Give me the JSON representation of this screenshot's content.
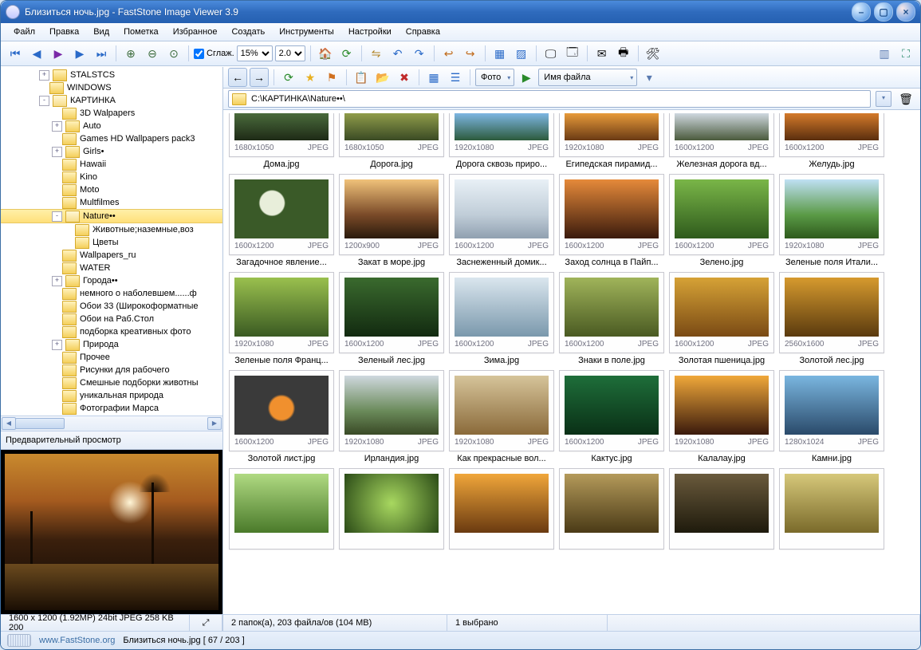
{
  "title": "Близиться ночь.jpg  -  FastStone Image Viewer 3.9",
  "menu": [
    "Файл",
    "Правка",
    "Вид",
    "Пометка",
    "Избранное",
    "Создать",
    "Инструменты",
    "Настройки",
    "Справка"
  ],
  "toolbar1": {
    "smooth_label": "Сглаж.",
    "zoom_pct": "15%",
    "zoom_x": "2.0"
  },
  "rtoolbar": {
    "combo1": "Фото",
    "combo2": "Имя файла"
  },
  "path": "С:\\КАРТИНКА\\Nature••\\",
  "preview_label": "Предварительный просмотр",
  "tree": [
    {
      "d": 3,
      "e": "+",
      "t": "STALSTCS"
    },
    {
      "d": 3,
      "e": "",
      "t": "WINDOWS"
    },
    {
      "d": 3,
      "e": "-",
      "t": "КАРТИНКА",
      "open": true
    },
    {
      "d": 4,
      "e": "",
      "t": "3D Walpapers"
    },
    {
      "d": 4,
      "e": "+",
      "t": "Auto"
    },
    {
      "d": 4,
      "e": "",
      "t": "Games HD Wallpapers pack3"
    },
    {
      "d": 4,
      "e": "+",
      "t": "Girls•"
    },
    {
      "d": 4,
      "e": "",
      "t": "Hawaii"
    },
    {
      "d": 4,
      "e": "",
      "t": "Kino"
    },
    {
      "d": 4,
      "e": "",
      "t": "Moto"
    },
    {
      "d": 4,
      "e": "",
      "t": "Multfilmes"
    },
    {
      "d": 4,
      "e": "-",
      "t": "Nature••",
      "sel": true,
      "open": true
    },
    {
      "d": 5,
      "e": "",
      "t": "Животные;наземные,воз"
    },
    {
      "d": 5,
      "e": "",
      "t": "Цветы"
    },
    {
      "d": 4,
      "e": "",
      "t": "Wallpapers_ru"
    },
    {
      "d": 4,
      "e": "",
      "t": "WATER"
    },
    {
      "d": 4,
      "e": "+",
      "t": "Города••"
    },
    {
      "d": 4,
      "e": "",
      "t": "немного о наболевшем......ф"
    },
    {
      "d": 4,
      "e": "",
      "t": "Обои 33 (Широкоформатные"
    },
    {
      "d": 4,
      "e": "",
      "t": "Обои на Раб.Стол"
    },
    {
      "d": 4,
      "e": "",
      "t": "подборка креативных фото"
    },
    {
      "d": 4,
      "e": "+",
      "t": "Природа"
    },
    {
      "d": 4,
      "e": "",
      "t": "Прочее"
    },
    {
      "d": 4,
      "e": "",
      "t": "Рисунки для рабочего"
    },
    {
      "d": 4,
      "e": "",
      "t": "Смешные подборки животны"
    },
    {
      "d": 4,
      "e": "",
      "t": "уникальная природа"
    },
    {
      "d": 4,
      "e": "",
      "t": "Фотографии Марса"
    }
  ],
  "thumbs": [
    [
      {
        "r": "1680x1050",
        "f": "JPEG",
        "n": "Дома.jpg",
        "bg": "linear-gradient(#4a6b3c,#1e2a16)"
      },
      {
        "r": "1680x1050",
        "f": "JPEG",
        "n": "Дорога.jpg",
        "bg": "linear-gradient(#8f9c4a,#3a4a24)"
      },
      {
        "r": "1920x1080",
        "f": "JPEG",
        "n": "Дорога сквозь приро...",
        "bg": "linear-gradient(#7db6e3,#2c5a3c)"
      },
      {
        "r": "1920x1080",
        "f": "JPEG",
        "n": "Египедская пирамид...",
        "bg": "linear-gradient(#e79a3a,#6a3a14)"
      },
      {
        "r": "1600x1200",
        "f": "JPEG",
        "n": "Железная дорога вд...",
        "bg": "linear-gradient(#cfd8e0,#4a5a3c)"
      },
      {
        "r": "1600x1200",
        "f": "JPEG",
        "n": "Желудь.jpg",
        "bg": "linear-gradient(#d47a2a,#5a2e0e)"
      }
    ],
    [
      {
        "r": "1600x1200",
        "f": "JPEG",
        "n": "Загадочное явление...",
        "bg": "radial-gradient(circle at 40% 40%,#e8eeda 0 18%,#3a5a28 20%)"
      },
      {
        "r": "1200x900",
        "f": "JPEG",
        "n": "Закат в море.jpg",
        "bg": "linear-gradient(#f0c27a,#7a4a28 60%,#2a1a0c)"
      },
      {
        "r": "1600x1200",
        "f": "JPEG",
        "n": "Заснеженный домик...",
        "bg": "linear-gradient(#e8f0f6,#c0cdd8 60%,#90a0b0)"
      },
      {
        "r": "1600x1200",
        "f": "JPEG",
        "n": "Заход солнца в Пайп...",
        "bg": "linear-gradient(#e68a3a,#3a1a0c)"
      },
      {
        "r": "1600x1200",
        "f": "JPEG",
        "n": "Зелено.jpg",
        "bg": "linear-gradient(#7ab648,#2e5a1c)"
      },
      {
        "r": "1920x1080",
        "f": "JPEG",
        "n": "Зеленые поля Итали...",
        "bg": "linear-gradient(#bfe0f4,#5a9a46 60%,#2e5a1c)"
      }
    ],
    [
      {
        "r": "1920x1080",
        "f": "JPEG",
        "n": "Зеленые поля Франц...",
        "bg": "linear-gradient(#9ac04e,#3a5a22)"
      },
      {
        "r": "1600x1200",
        "f": "JPEG",
        "n": "Зеленый лес.jpg",
        "bg": "linear-gradient(#3a6a2e,#122a10)"
      },
      {
        "r": "1600x1200",
        "f": "JPEG",
        "n": "Зима.jpg",
        "bg": "linear-gradient(#dae6ee,#7a98ac)"
      },
      {
        "r": "1600x1200",
        "f": "JPEG",
        "n": "Знаки в поле.jpg",
        "bg": "linear-gradient(#a0b45a,#4a5a22)"
      },
      {
        "r": "1600x1200",
        "f": "JPEG",
        "n": "Золотая пшеница.jpg",
        "bg": "linear-gradient(#d6a236,#7a4a14)"
      },
      {
        "r": "2560x1600",
        "f": "JPEG",
        "n": "Золотой лес.jpg",
        "bg": "linear-gradient(#d69a2e,#5a3a0e)"
      }
    ],
    [
      {
        "r": "1600x1200",
        "f": "JPEG",
        "n": "Золотой лист.jpg",
        "bg": "radial-gradient(circle at 50% 55%,#f0902e 0 20%,#3a3a3a 24%)"
      },
      {
        "r": "1920x1080",
        "f": "JPEG",
        "n": "Ирландия.jpg",
        "bg": "linear-gradient(#cfd8de,#6a8a5a 60%,#3a4a26)"
      },
      {
        "r": "1920x1080",
        "f": "JPEG",
        "n": "Как прекрасные вол...",
        "bg": "linear-gradient(#d6c49a,#8a6a3a)"
      },
      {
        "r": "1600x1200",
        "f": "JPEG",
        "n": "Кактус.jpg",
        "bg": "linear-gradient(#1e6e3a,#0a3016)"
      },
      {
        "r": "1920x1080",
        "f": "JPEG",
        "n": "Калалау.jpg",
        "bg": "linear-gradient(#f0a83a,#3a1a0c)"
      },
      {
        "r": "1280x1024",
        "f": "JPEG",
        "n": "Камни.jpg",
        "bg": "linear-gradient(#7ab6e0,#2a4a6a)"
      }
    ],
    [
      {
        "r": "",
        "f": "",
        "n": "",
        "bg": "linear-gradient(#b0da82,#4a7a2a)"
      },
      {
        "r": "",
        "f": "",
        "n": "",
        "bg": "radial-gradient(circle,#a8d860,#2a4a16)"
      },
      {
        "r": "",
        "f": "",
        "n": "",
        "bg": "linear-gradient(#f0a63a,#6a3a10)"
      },
      {
        "r": "",
        "f": "",
        "n": "",
        "bg": "linear-gradient(#b49a5a,#4a3a16)"
      },
      {
        "r": "",
        "f": "",
        "n": "",
        "bg": "linear-gradient(#6a5a3c,#1e1a0c)"
      },
      {
        "r": "",
        "f": "",
        "n": "",
        "bg": "linear-gradient(#d6c87a,#7a6a2a)"
      }
    ]
  ],
  "left_status": "1600 x 1200 (1.92MP)   24bit JPEG   258 KB   200",
  "right_status": {
    "folders": "2 папок(а), 203 файла/ов (104 MB)",
    "selected": "1 выбрано"
  },
  "footer": {
    "site": "www.FastStone.org",
    "progress": "Близиться ночь.jpg [ 67 / 203 ]"
  }
}
